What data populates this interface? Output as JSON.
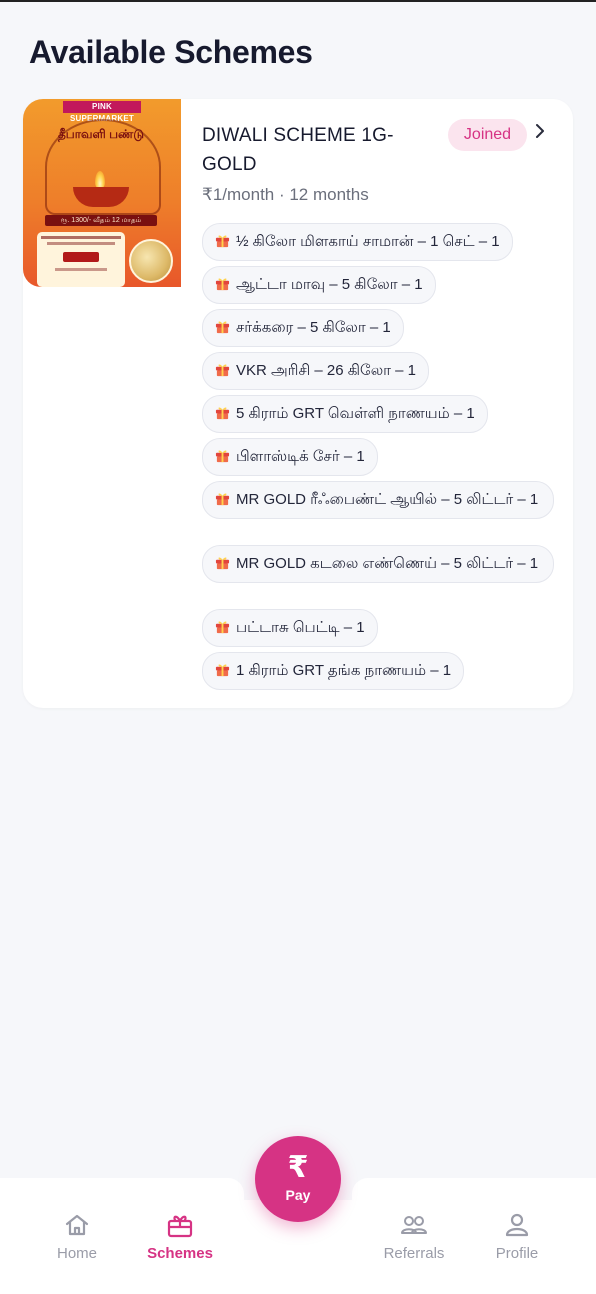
{
  "page": {
    "title": "Available Schemes"
  },
  "scheme": {
    "title": "DIWALI SCHEME 1G-GOLD",
    "status": "Joined",
    "billing": "₹1/month · 12 months",
    "poster": {
      "brand": "PINK SUPERMARKET",
      "headline": "தீபாவளி பண்டு",
      "price_line": "ரூ. 1300/- வீதம் 12 மாதம்"
    },
    "gifts": [
      "½ கிலோ மிளகாய் சாமான் – 1 செட் – 1",
      "ஆட்டா மாவு – 5 கிலோ – 1",
      "சர்க்கரை – 5 கிலோ – 1",
      "VKR அரிசி – 26 கிலோ – 1",
      "5 கிராம் GRT வெள்ளி நாணயம் – 1",
      "பிளாஸ்டிக் சேர் – 1",
      "MR GOLD ரீஃபைண்ட் ஆயில் – 5 லிட்டர் – 1",
      "MR GOLD கடலை எண்ணெய் – 5 லிட்டர் – 1",
      "பட்டாசு பெட்டி – 1",
      "1 கிராம் GRT தங்க நாணயம்  – 1"
    ]
  },
  "nav": {
    "home": "Home",
    "schemes": "Schemes",
    "pay": "Pay",
    "pay_symbol": "₹",
    "referrals": "Referrals",
    "profile": "Profile",
    "active": "schemes"
  },
  "colors": {
    "accent": "#d63384",
    "badge_bg": "#fbe4ee",
    "background": "#f6f7fa",
    "inactive_nav": "#9a9ca8"
  }
}
